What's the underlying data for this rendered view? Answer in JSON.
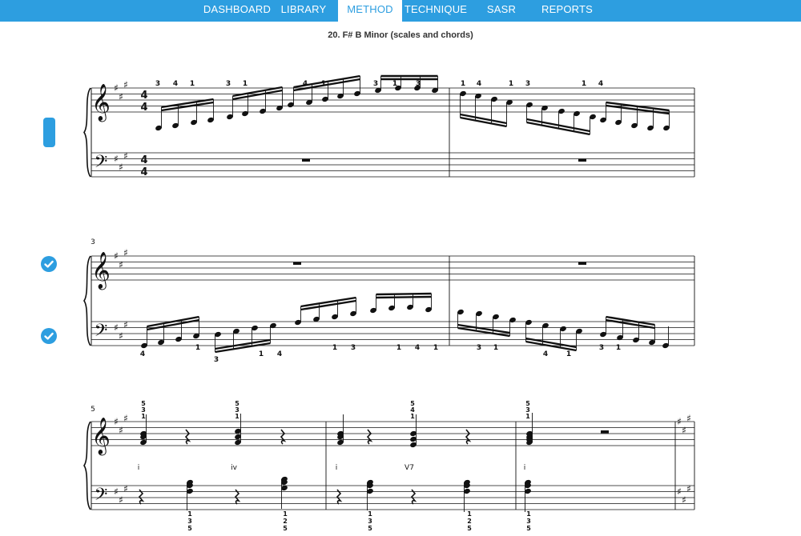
{
  "nav": {
    "items": [
      {
        "label": "DASHBOARD",
        "active": false
      },
      {
        "label": "LIBRARY",
        "active": false
      },
      {
        "label": "METHOD",
        "active": true
      },
      {
        "label": "TECHNIQUE",
        "active": false
      },
      {
        "label": "SASR",
        "active": false
      },
      {
        "label": "REPORTS",
        "active": false
      }
    ]
  },
  "piece": {
    "title": "20. F# B Minor (scales and chords)"
  },
  "systems": [
    {
      "measure_number": "",
      "fingering_top": [
        "3",
        "4",
        "1",
        "3",
        "1",
        "4",
        "1",
        "3",
        "1",
        "3",
        "1",
        "4",
        "1",
        "3",
        "1",
        "4"
      ],
      "fingering_bottom": []
    },
    {
      "measure_number": "3",
      "fingering_top": [],
      "fingering_bottom": [
        "4",
        "1",
        "3",
        "1",
        "4",
        "1",
        "3",
        "1",
        "4",
        "1",
        "3",
        "1",
        "4",
        "1",
        "3",
        "1"
      ]
    },
    {
      "measure_number": "5",
      "fingering_top": [
        "5",
        "3",
        "1",
        "5",
        "3",
        "1",
        "5",
        "4",
        "1",
        "5",
        "3",
        "1"
      ],
      "fingering_bottom": [
        "1",
        "3",
        "5",
        "1",
        "2",
        "5",
        "1",
        "3",
        "5",
        "1",
        "2",
        "5",
        "1",
        "3",
        "5"
      ],
      "chord_symbols": [
        "i",
        "iv",
        "i",
        "V7",
        "i"
      ]
    }
  ],
  "sidebar": {
    "active_marker": "selected-system",
    "checks": [
      "completed",
      "completed"
    ]
  },
  "colors": {
    "accent": "#2d9ee0",
    "ink": "#111111"
  }
}
